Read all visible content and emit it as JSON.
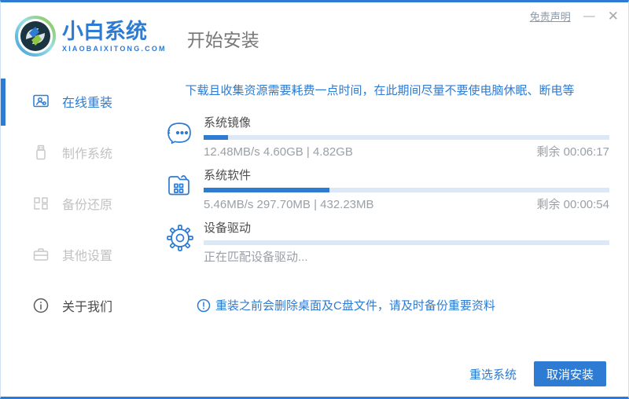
{
  "header": {
    "brand": "小白系统",
    "brand_domain": "XIAOBAIXITONG.COM",
    "page_title": "开始安装",
    "disclaimer_label": "免责声明",
    "minimize_glyph": "—",
    "close_glyph": "✕"
  },
  "sidebar": {
    "items": [
      {
        "label": "在线重装",
        "icon": "monitor-user-icon",
        "active": true
      },
      {
        "label": "制作系统",
        "icon": "usb-drive-icon",
        "active": false
      },
      {
        "label": "备份还原",
        "icon": "backup-blocks-icon",
        "active": false
      },
      {
        "label": "其他设置",
        "icon": "briefcase-icon",
        "active": false
      },
      {
        "label": "关于我们",
        "icon": "info-circle-icon",
        "active": false
      }
    ]
  },
  "main": {
    "warning": "下载且收集资源需要耗费一点时间，在此期间尽量不要使电脑休眠、断电等",
    "tasks": [
      {
        "name": "系统镜像",
        "icon": "face-icon",
        "progress": 6,
        "stats": "12.48MB/s 4.60GB | 4.82GB",
        "remaining": "剩余 00:06:17"
      },
      {
        "name": "系统软件",
        "icon": "folder-grid-icon",
        "progress": 31,
        "stats": "5.46MB/s 297.70MB | 432.23MB",
        "remaining": "剩余 00:00:54"
      },
      {
        "name": "设备驱动",
        "icon": "gear-icon",
        "progress": 0,
        "stats": "正在匹配设备驱动...",
        "remaining": ""
      }
    ],
    "note": "重装之前会删除桌面及C盘文件，请及时备份重要资料"
  },
  "footer": {
    "reselect_label": "重选系统",
    "cancel_label": "取消安装"
  },
  "colors": {
    "accent_blue": "#2d7bd2",
    "progress_track": "#dde8f6",
    "inactive_gray": "#c2c2c2",
    "stats_gray": "#9aa0a6"
  }
}
